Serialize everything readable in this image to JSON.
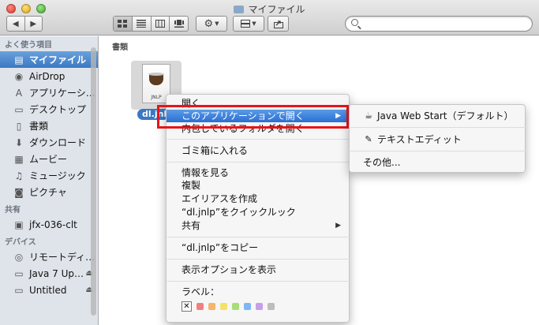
{
  "window": {
    "title": "マイファイル"
  },
  "toolbar": {
    "back_icon": "chevron-left-icon",
    "forward_icon": "chevron-right-icon",
    "view_modes": [
      "icon-view-icon",
      "list-view-icon",
      "column-view-icon",
      "coverflow-view-icon"
    ],
    "action_icon": "gear-icon",
    "arrange_icon": "arrange-icon",
    "share_icon": "share-icon",
    "search_placeholder": ""
  },
  "sidebar": {
    "favorites_header": "よく使う項目",
    "favorites": [
      {
        "label": "マイファイル",
        "icon": "all-files-icon",
        "selected": true
      },
      {
        "label": "AirDrop",
        "icon": "airdrop-icon"
      },
      {
        "label": "アプリケーシ…",
        "icon": "applications-icon"
      },
      {
        "label": "デスクトップ",
        "icon": "desktop-icon"
      },
      {
        "label": "書類",
        "icon": "documents-icon"
      },
      {
        "label": "ダウンロード",
        "icon": "downloads-icon"
      },
      {
        "label": "ムービー",
        "icon": "movies-icon"
      },
      {
        "label": "ミュージック",
        "icon": "music-icon"
      },
      {
        "label": "ピクチャ",
        "icon": "pictures-icon"
      }
    ],
    "shared_header": "共有",
    "shared": [
      {
        "label": "jfx-036-clt",
        "icon": "computer-icon"
      }
    ],
    "devices_header": "デバイス",
    "devices": [
      {
        "label": "リモートディ…",
        "icon": "disc-icon"
      },
      {
        "label": "Java 7 Up…",
        "icon": "disk-icon",
        "eject": true
      },
      {
        "label": "Untitled",
        "icon": "disk-icon",
        "eject": true
      }
    ]
  },
  "content": {
    "section_label": "書類",
    "file": {
      "name": "dl.jnlp",
      "badge_text": "JNLP",
      "icon": "java-jnlp-file-icon"
    }
  },
  "context_menu": {
    "items": [
      {
        "label": "開く"
      },
      {
        "label": "このアプリケーションで開く",
        "submenu": true,
        "highlighted": true
      },
      {
        "label": "内包しているフォルダを開く"
      },
      {
        "label": "ゴミ箱に入れる"
      },
      {
        "label": "情報を見る"
      },
      {
        "label": "複製"
      },
      {
        "label": "エイリアスを作成"
      },
      {
        "label": "“dl.jnlp”をクイックルック"
      },
      {
        "label": "共有",
        "submenu": true
      },
      {
        "label": "“dl.jnlp”をコピー"
      },
      {
        "label": "表示オプションを表示"
      },
      {
        "label": "ラベル："
      }
    ],
    "label_colors": [
      "#f08080",
      "#f3b66a",
      "#f2e26a",
      "#a9dc7a",
      "#7fb6f2",
      "#c79ee8",
      "#bdbdbd"
    ],
    "highlight_box_color": "#e8141a"
  },
  "submenu": {
    "items": [
      {
        "label": "Java Web Start（デフォルト）",
        "icon": "java-web-start-icon"
      },
      {
        "label": "テキストエディット",
        "icon": "textedit-icon"
      },
      {
        "label": "その他..."
      }
    ]
  }
}
